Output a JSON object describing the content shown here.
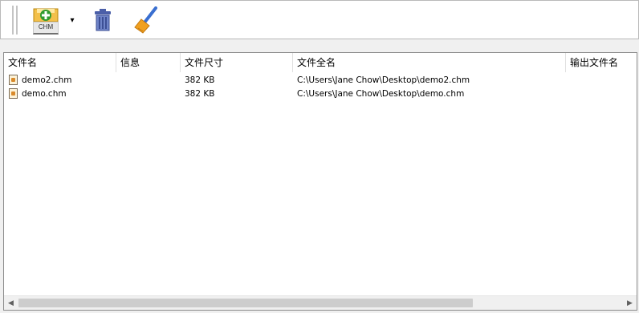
{
  "toolbar": {
    "add_button_badge": "CHM",
    "dropdown_glyph": "▾",
    "icons": [
      "add-chm-icon",
      "trash-icon",
      "broom-icon"
    ]
  },
  "list": {
    "columns": [
      "文件名",
      "信息",
      "文件尺寸",
      "文件全名",
      "输出文件名"
    ],
    "rows": [
      {
        "name": "demo2.chm",
        "info": "",
        "size": "382 KB",
        "fullname": "C:\\Users\\Jane Chow\\Desktop\\demo2.chm",
        "output": ""
      },
      {
        "name": "demo.chm",
        "info": "",
        "size": "382 KB",
        "fullname": "C:\\Users\\Jane Chow\\Desktop\\demo.chm",
        "output": ""
      }
    ]
  },
  "scrollbar": {
    "left_arrow": "◀",
    "right_arrow": "▶",
    "thumb_fraction": 0.73
  },
  "colors": {
    "trash": "#5a6fb5",
    "broom_handle": "#3a6fd0",
    "broom_head": "#f0a020",
    "add_green": "#2f9a2f"
  }
}
